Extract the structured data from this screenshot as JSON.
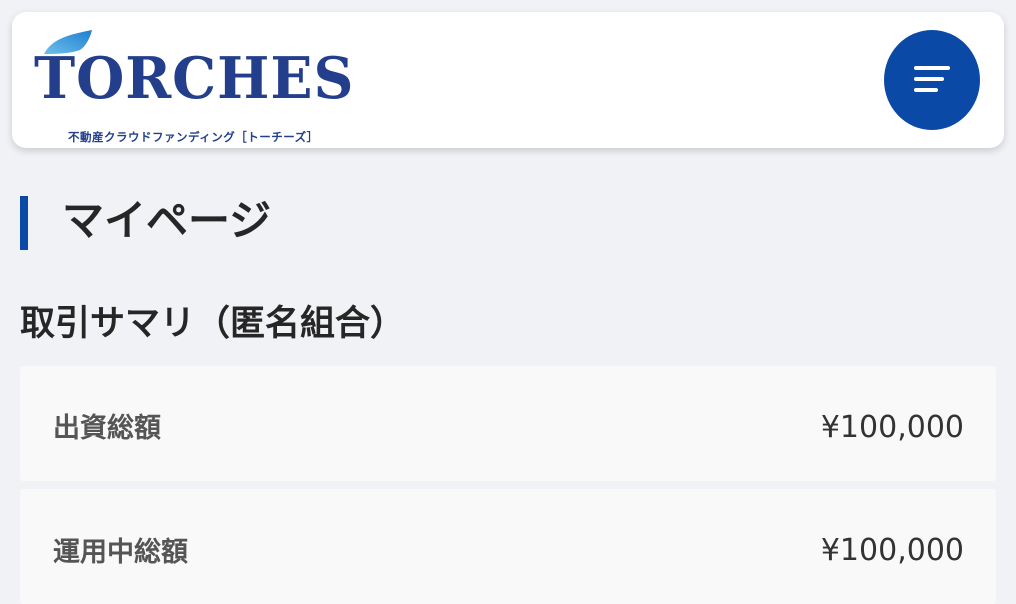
{
  "header": {
    "logo_text": "TORCHES",
    "logo_subtitle": "不動産クラウドファンディング［トーチーズ］",
    "menu_icon": "hamburger-menu-icon",
    "brand_color": "#0a4aa6",
    "logo_color": "#233f8c"
  },
  "page": {
    "title": "マイページ"
  },
  "summary": {
    "section_title": "取引サマリ（匿名組合）",
    "rows": [
      {
        "label": "出資総額",
        "value": "¥100,000"
      },
      {
        "label": "運用中総額",
        "value": "¥100,000"
      }
    ]
  }
}
